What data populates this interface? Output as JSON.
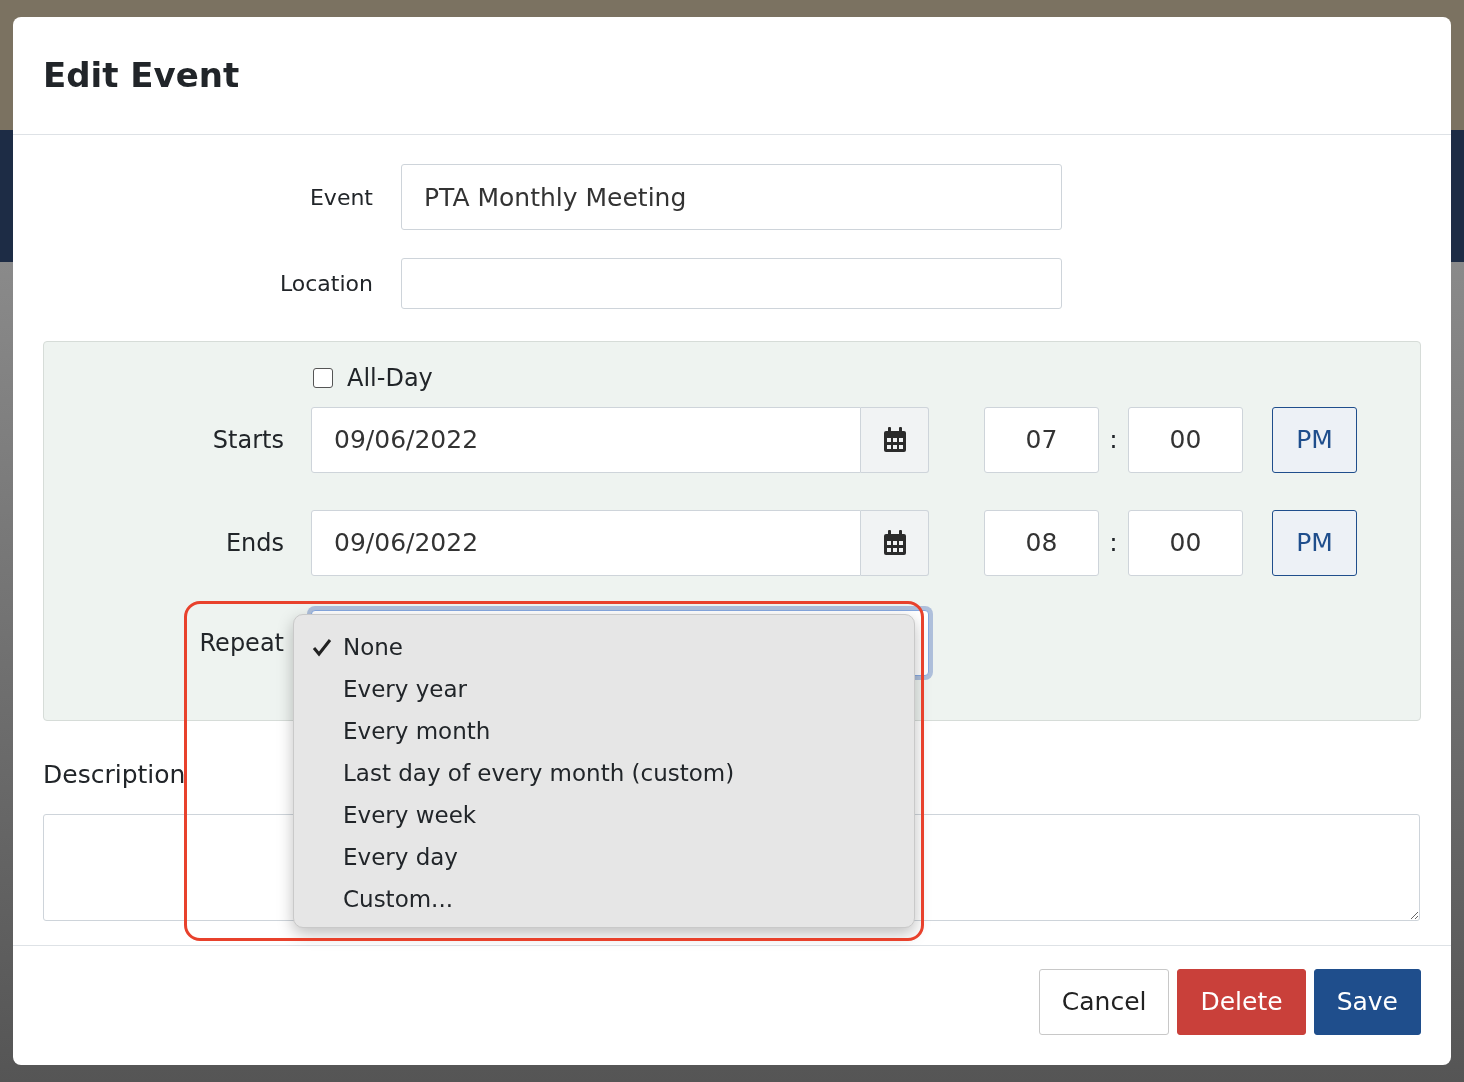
{
  "dialog": {
    "title": "Edit Event"
  },
  "event": {
    "label": "Event",
    "value": "PTA Monthly Meeting"
  },
  "location": {
    "label": "Location"
  },
  "all_day": {
    "label": "All-Day",
    "checked": false
  },
  "times": [
    {
      "label": "Starts",
      "date": "09/06/2022",
      "hour": "07",
      "separator": ":",
      "minute": "00",
      "ampm": "PM"
    },
    {
      "label": "Ends",
      "date": "09/06/2022",
      "hour": "08",
      "separator": ":",
      "minute": "00",
      "ampm": "PM"
    }
  ],
  "repeat": {
    "label": "Repeat",
    "expanded": true,
    "options": [
      {
        "label": "None",
        "selected": true
      },
      {
        "label": "Every year",
        "selected": false
      },
      {
        "label": "Every month",
        "selected": false
      },
      {
        "label": "Last day of every month (custom)",
        "selected": false
      },
      {
        "label": "Every week",
        "selected": false
      },
      {
        "label": "Every day",
        "selected": false
      },
      {
        "label": "Custom...",
        "selected": false
      }
    ]
  },
  "description": {
    "label": "Description"
  },
  "buttons": [
    {
      "label": "Cancel",
      "kind": "cancel"
    },
    {
      "label": "Delete",
      "kind": "delete"
    },
    {
      "label": "Save",
      "kind": "save"
    }
  ]
}
